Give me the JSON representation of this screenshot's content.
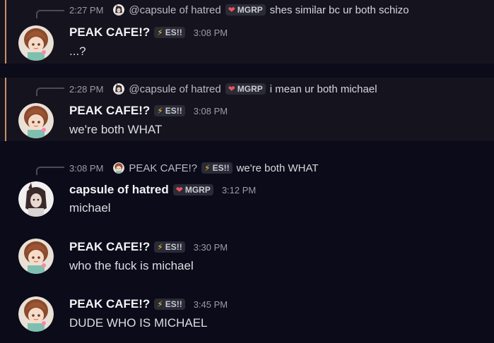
{
  "colors": {
    "background": "#0b0b1a",
    "highlight_bg": "#15131e",
    "highlight_bar": "#c99066",
    "es_icon": "#f5c531",
    "mgrp_icon": "#e8555f"
  },
  "icons": {
    "es": "lightning-icon",
    "mgrp": "heart-icon"
  },
  "tags": {
    "es": "ES!!",
    "mgrp": "MGRP"
  },
  "messages": [
    {
      "reply": {
        "time": "2:27 PM",
        "author": "@capsule of hatred",
        "tag": "MGRP",
        "text": "shes similar bc ur both schizo"
      },
      "author": "PEAK CAFE!?",
      "tag": "ES!!",
      "time": "3:08 PM",
      "content": "...?"
    },
    {
      "reply": {
        "time": "2:28 PM",
        "author": "@capsule of hatred",
        "tag": "MGRP",
        "text": "i mean ur both michael"
      },
      "author": "PEAK CAFE!?",
      "tag": "ES!!",
      "time": "3:08 PM",
      "content": "we're both WHAT"
    },
    {
      "reply": {
        "time": "3:08 PM",
        "author": "PEAK CAFE!?",
        "tag": "ES!!",
        "text": "we're both WHAT"
      },
      "author": "capsule of hatred",
      "tag": "MGRP",
      "time": "3:12 PM",
      "content": "michael"
    },
    {
      "author": "PEAK CAFE!?",
      "tag": "ES!!",
      "time": "3:30 PM",
      "content": "who the fuck is michael"
    },
    {
      "author": "PEAK CAFE!?",
      "tag": "ES!!",
      "time": "3:45 PM",
      "content": "DUDE WHO IS MICHAEL"
    }
  ]
}
